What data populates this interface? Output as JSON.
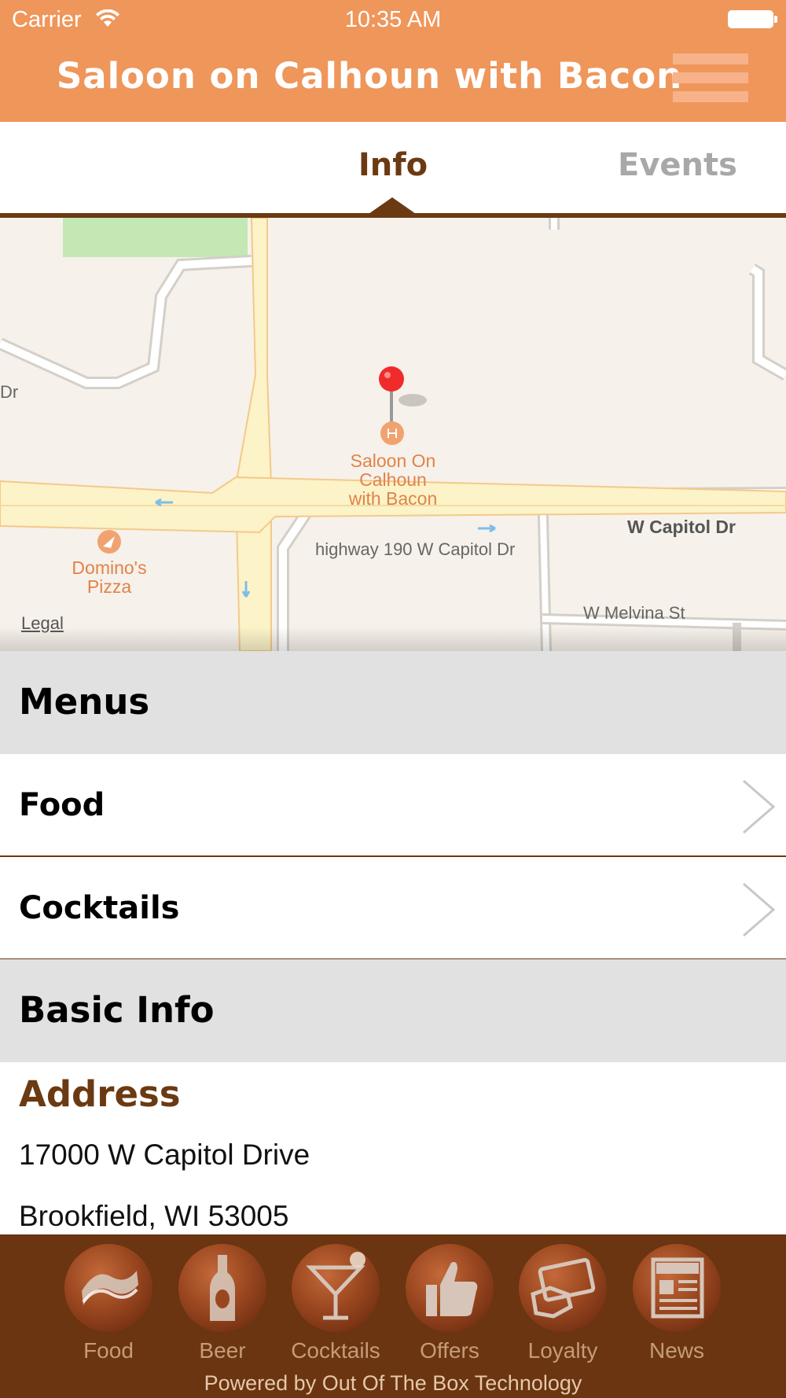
{
  "status": {
    "carrier": "Carrier",
    "time": "10:35 AM"
  },
  "header": {
    "title": "Saloon on Calhoun with Bacon"
  },
  "tabs": [
    {
      "label": "Info",
      "active": true
    },
    {
      "label": "Events",
      "active": false
    }
  ],
  "map": {
    "pin_label": "Saloon On Calhoun with Bacon",
    "pin_lines": [
      "Saloon On",
      "Calhoun",
      "with Bacon"
    ],
    "poi_lines": [
      "Domino's",
      "Pizza"
    ],
    "streets": {
      "dr_fragment": "Dr",
      "capitol": "W Capitol Dr",
      "highway": "highway 190 W Capitol Dr",
      "melvina": "W Melvina St"
    },
    "legal": "Legal"
  },
  "menus": {
    "header": "Menus",
    "items": [
      {
        "label": "Food"
      },
      {
        "label": "Cocktails"
      }
    ]
  },
  "basic_info": {
    "header": "Basic Info",
    "address_title": "Address",
    "address_line1": "17000 W Capitol Drive",
    "address_line2": "Brookfield, WI 53005"
  },
  "bottom_nav": {
    "items": [
      {
        "label": "Food",
        "icon": "bacon-icon"
      },
      {
        "label": "Beer",
        "icon": "beer-bottle-icon"
      },
      {
        "label": "Cocktails",
        "icon": "martini-icon"
      },
      {
        "label": "Offers",
        "icon": "thumbs-up-icon"
      },
      {
        "label": "Loyalty",
        "icon": "loyalty-card-icon"
      },
      {
        "label": "News",
        "icon": "newspaper-icon"
      }
    ],
    "powered_by": "Powered by Out Of The Box Technology"
  },
  "colors": {
    "header": "#ef965b",
    "brown": "#6b3a12",
    "section_bg": "#e1e1e1",
    "bottom_bar": "#6a3510"
  }
}
